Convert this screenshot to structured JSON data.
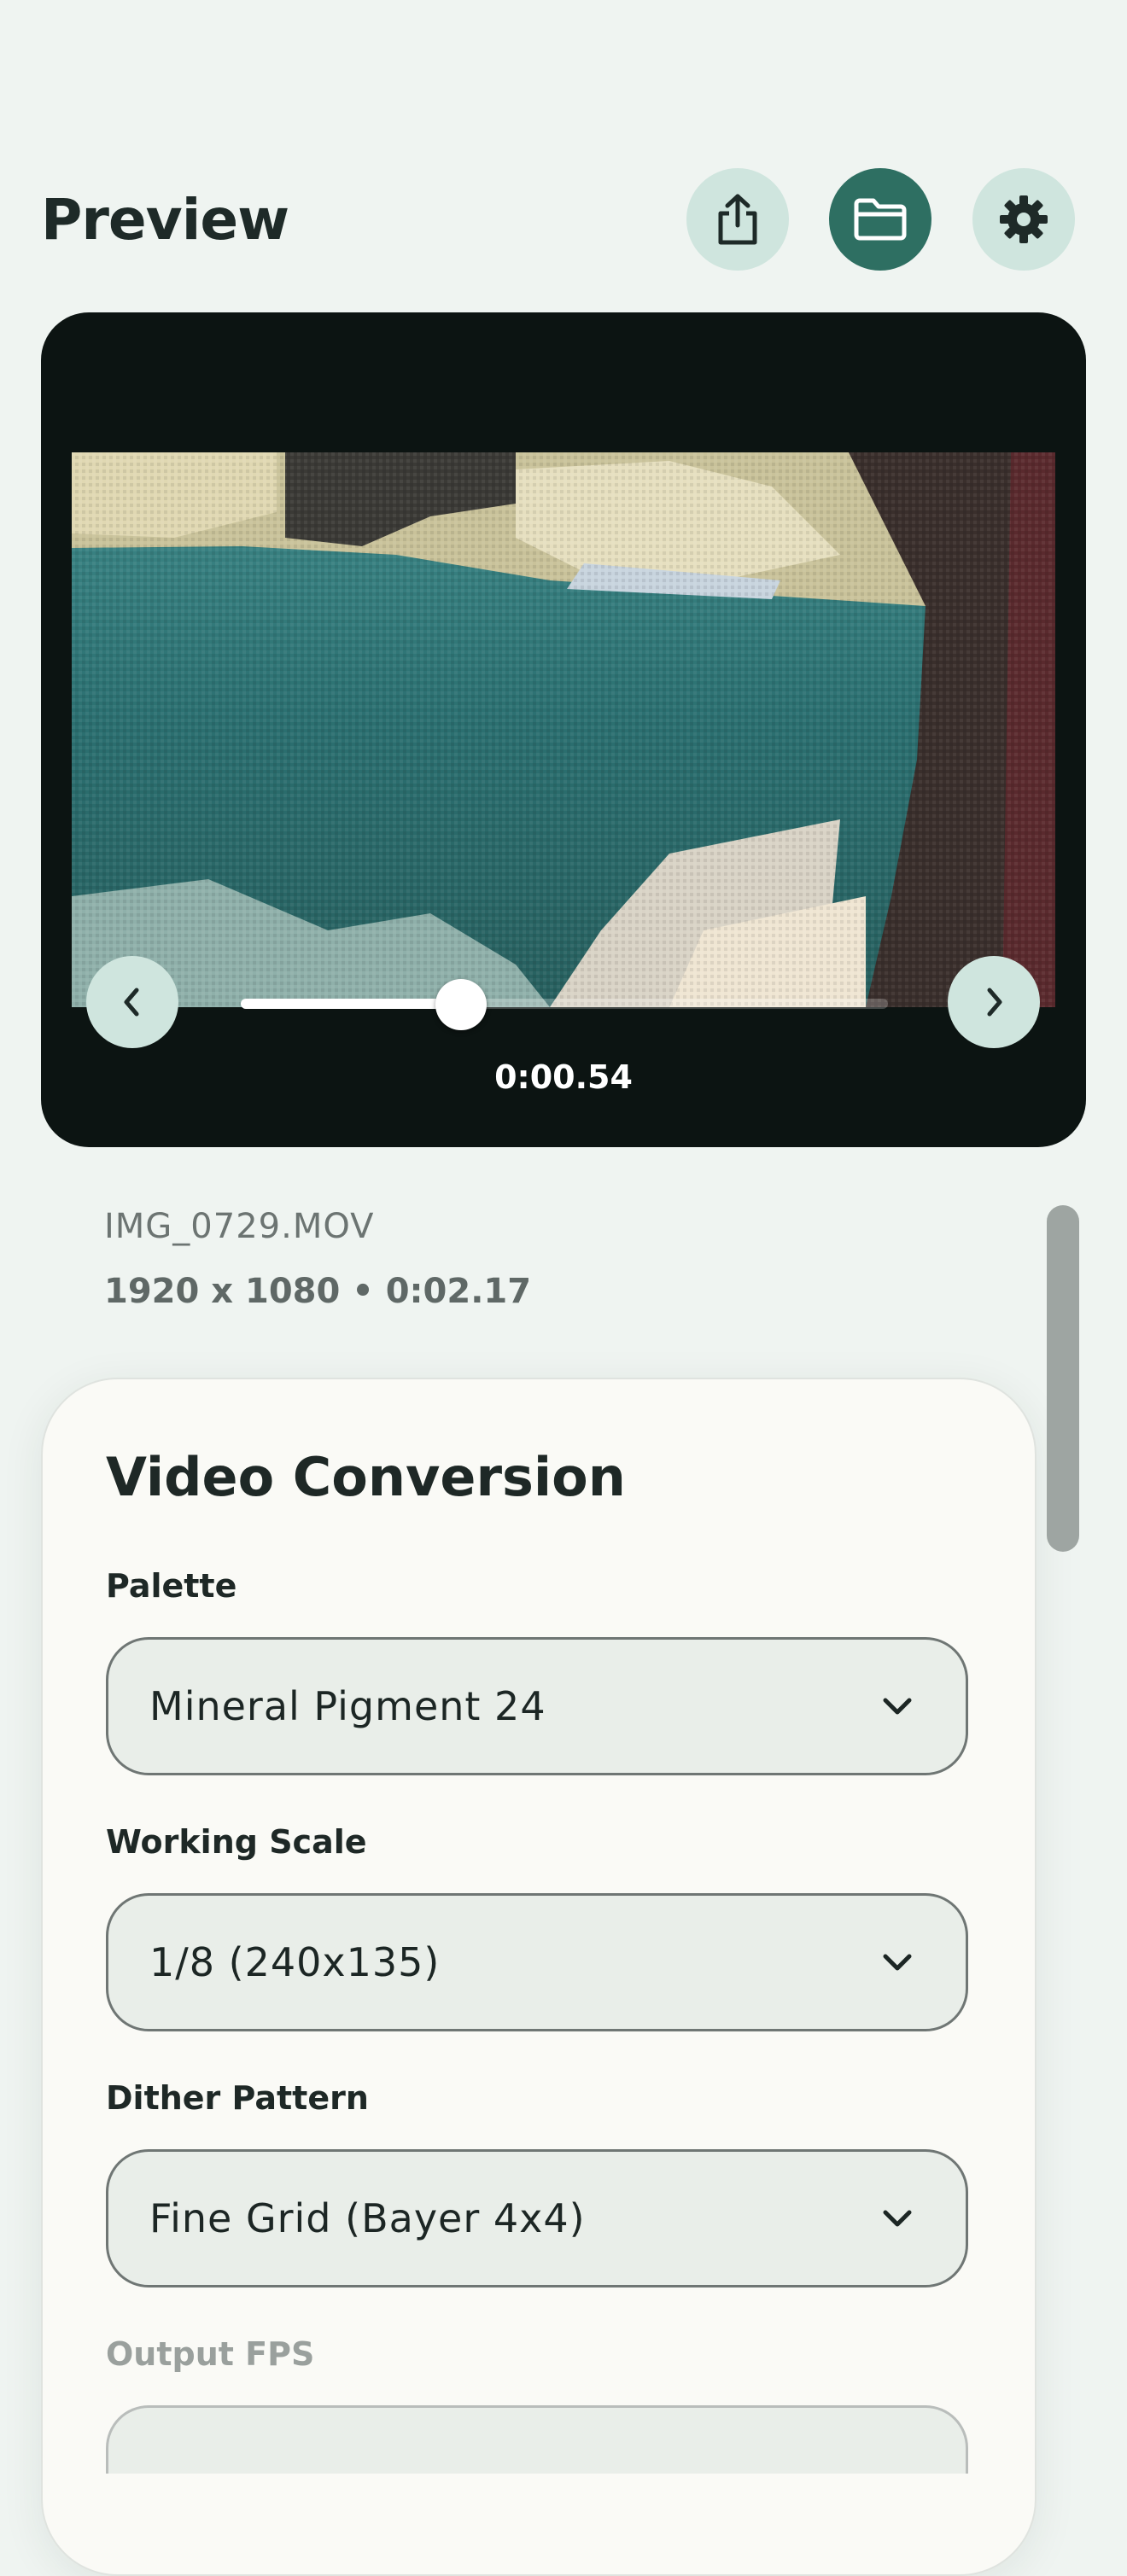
{
  "header": {
    "title": "Preview",
    "buttons": {
      "share": "share-icon",
      "open": "folder-icon",
      "settings": "gear-icon"
    }
  },
  "player": {
    "timecode": "0:00.54",
    "progress": 0.34
  },
  "file": {
    "name": "IMG_0729.MOV",
    "meta": "1920 x 1080 • 0:02.17"
  },
  "conversion": {
    "title": "Video Conversion",
    "fields": [
      {
        "label": "Palette",
        "value": "Mineral Pigment 24"
      },
      {
        "label": "Working Scale",
        "value": "1/8 (240x135)"
      },
      {
        "label": "Dither Pattern",
        "value": "Fine Grid (Bayer 4x4)"
      },
      {
        "label": "Output FPS",
        "value": ""
      }
    ]
  },
  "colors": {
    "background": "#eff4f1",
    "accent": "#2e6f62",
    "button_light": "#cfe5de",
    "player_bg": "#0c1412"
  }
}
